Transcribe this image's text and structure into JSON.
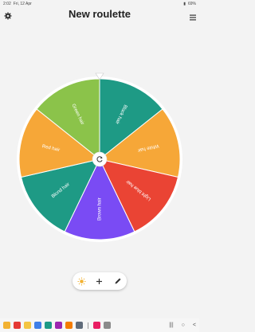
{
  "status_bar": {
    "time": "2:02",
    "date": "Fri, 12 Apr",
    "battery": "69%"
  },
  "header": {
    "title": "New roulette",
    "settings_icon": "gear-icon",
    "menu_icon": "hamburger-menu-icon"
  },
  "wheel": {
    "segments": [
      {
        "label": "Black hair",
        "color": "#1e9a85"
      },
      {
        "label": "White hair",
        "color": "#f6a738"
      },
      {
        "label": "Light blue hair",
        "color": "#ea4434"
      },
      {
        "label": "Brown hair",
        "color": "#7a4bf4"
      },
      {
        "label": "Blond hair",
        "color": "#1e9a85"
      },
      {
        "label": "Red hair",
        "color": "#f6a738"
      },
      {
        "label": "Green hair",
        "color": "#8bc34a"
      }
    ],
    "center_icon": "refresh-icon",
    "pointer_icon": "pointer-triangle-icon"
  },
  "toolbar": {
    "items": [
      {
        "icon": "sun-icon"
      },
      {
        "icon": "plus-icon"
      },
      {
        "icon": "pencil-icon"
      }
    ]
  },
  "nav_bar": {
    "apps": [
      {
        "name": "gallery-app-icon",
        "color": "#f2b233"
      },
      {
        "name": "red-app-icon",
        "color": "#e53935"
      },
      {
        "name": "keep-app-icon",
        "color": "#f4c542"
      },
      {
        "name": "blue-app-icon",
        "color": "#3f7fe8"
      },
      {
        "name": "teal-app-icon",
        "color": "#1e9a85"
      },
      {
        "name": "purple-app-icon",
        "color": "#9c27b0"
      },
      {
        "name": "orange-app-icon",
        "color": "#f57c00"
      },
      {
        "name": "settings-app-icon",
        "color": "#5f6b7a"
      },
      {
        "name": "pink-app-icon",
        "color": "#e91e63"
      },
      {
        "name": "gray-app-icon",
        "color": "#8b8b8b"
      }
    ]
  }
}
